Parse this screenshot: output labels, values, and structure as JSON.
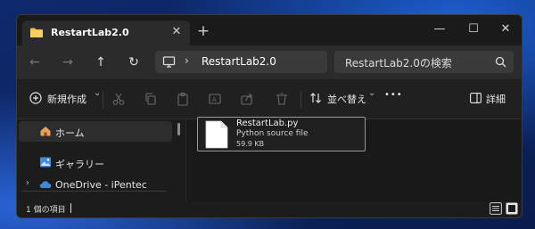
{
  "window": {
    "tab_title": "RestartLab2.0",
    "tab_close": "✕",
    "new_tab": "+",
    "minimize": "—",
    "maximize": "☐",
    "close": "✕"
  },
  "nav": {
    "back": "←",
    "forward": "→",
    "up": "↑",
    "refresh": "↻",
    "address_chevron": "›",
    "address_path": "RestartLab2.0",
    "search_placeholder": "RestartLab2.0の検索"
  },
  "commands": {
    "new_label": "新規作成",
    "new_chevron": "⌄",
    "sort_label": "並べ替え",
    "sort_chevron": "⌄",
    "more": "•••",
    "details_label": "詳細",
    "icons": [
      "cut-icon",
      "copy-icon",
      "paste-icon",
      "rename-icon",
      "share-icon",
      "delete-icon"
    ]
  },
  "sidebar": {
    "items": [
      {
        "label": "ホーム",
        "icon": "home-icon",
        "selected": true
      },
      {
        "label": "ギャラリー",
        "icon": "gallery-icon",
        "selected": false
      },
      {
        "label": "OneDrive - iPentec",
        "icon": "cloud-icon",
        "selected": false,
        "expand": "›"
      }
    ]
  },
  "files": [
    {
      "name": "RestartLab.py",
      "type": "Python source file",
      "size": "59.9 KB",
      "icon": "document-icon"
    }
  ],
  "status": {
    "item_count": "1 個の項目"
  },
  "colors": {
    "folder": "#f3c14b",
    "window_bg": "#1c1c1c",
    "desktop": "#0d2a6b",
    "onedrive": "#3b8ce0"
  }
}
